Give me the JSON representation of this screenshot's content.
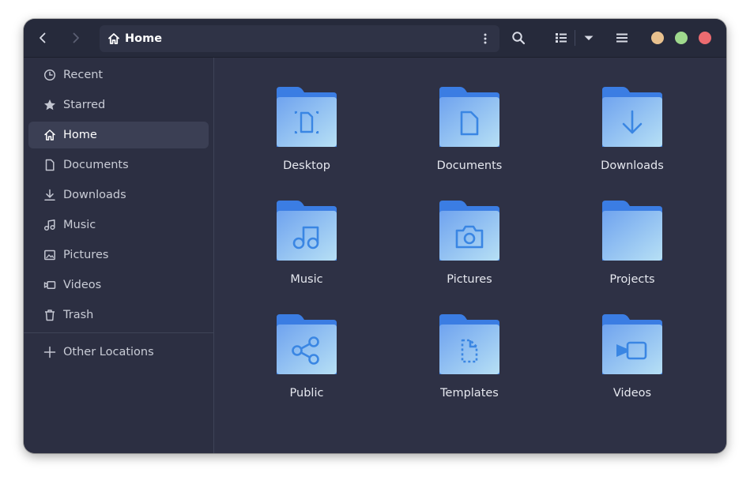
{
  "header": {
    "path": {
      "label": "Home",
      "icon": "home-icon"
    },
    "buttons": [
      "back-icon",
      "forward-icon",
      "kebab-menu-icon",
      "search-icon",
      "list-view-icon",
      "chevron-down-icon",
      "hamburger-menu-icon"
    ],
    "window_controls": {
      "minimize": "#e9c18e",
      "maximize": "#9fd98d",
      "close": "#ec6b70"
    }
  },
  "sidebar": {
    "items": [
      {
        "label": "Recent",
        "icon": "clock-icon"
      },
      {
        "label": "Starred",
        "icon": "star-icon"
      },
      {
        "label": "Home",
        "icon": "home-icon",
        "active": true
      },
      {
        "label": "Documents",
        "icon": "document-icon"
      },
      {
        "label": "Downloads",
        "icon": "download-icon"
      },
      {
        "label": "Music",
        "icon": "music-icon"
      },
      {
        "label": "Pictures",
        "icon": "picture-icon"
      },
      {
        "label": "Videos",
        "icon": "video-icon"
      },
      {
        "label": "Trash",
        "icon": "trash-icon"
      }
    ],
    "other": {
      "label": "Other Locations",
      "icon": "plus-icon"
    }
  },
  "folders": [
    {
      "label": "Desktop",
      "icon": "desktop-glyph"
    },
    {
      "label": "Documents",
      "icon": "document-glyph"
    },
    {
      "label": "Downloads",
      "icon": "download-glyph"
    },
    {
      "label": "Music",
      "icon": "music-glyph"
    },
    {
      "label": "Pictures",
      "icon": "camera-glyph"
    },
    {
      "label": "Projects",
      "icon": "none"
    },
    {
      "label": "Public",
      "icon": "share-glyph"
    },
    {
      "label": "Templates",
      "icon": "template-glyph"
    },
    {
      "label": "Videos",
      "icon": "video-glyph"
    }
  ],
  "colors": {
    "folder_back": "#3b7de3",
    "folder_front_top": "#6fa3ef",
    "folder_front_bottom": "#b3dcf5",
    "glyph": "#3a86e3"
  }
}
